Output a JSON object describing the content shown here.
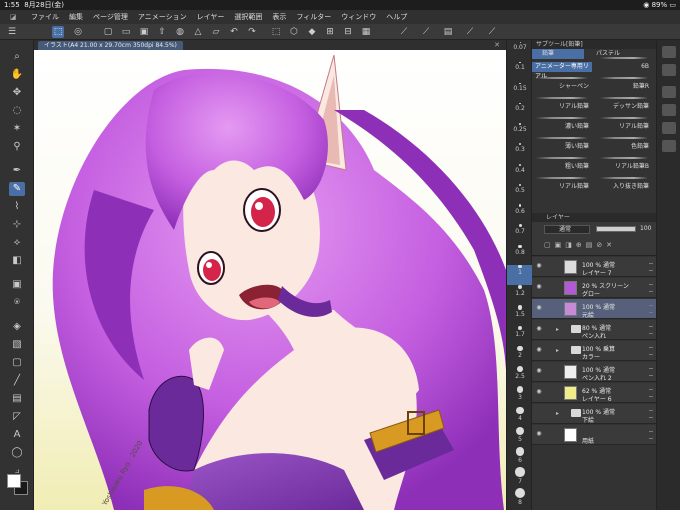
{
  "status": {
    "time": "1:55",
    "date": "8月28日(金)",
    "battery": "89%"
  },
  "menu": {
    "items": [
      "ファイル",
      "編集",
      "ページ管理",
      "アニメーション",
      "レイヤー",
      "選択範囲",
      "表示",
      "フィルター",
      "ウィンドウ",
      "ヘルプ"
    ]
  },
  "document": {
    "tab_label": "イラスト(A4 21.00 x 29.70cm 350dpi 84.5%)"
  },
  "brush_sizes": [
    "0.07",
    "0.1",
    "0.15",
    "0.2",
    "0.25",
    "0.3",
    "0.4",
    "0.5",
    "0.6",
    "0.7",
    "0.8",
    "1",
    "1.2",
    "1.5",
    "1.7",
    "2",
    "2.5",
    "3",
    "4",
    "5",
    "6",
    "7",
    "8"
  ],
  "active_brush_size": "1",
  "subtool": {
    "title": "サブツール[鉛筆]",
    "tabs": [
      "鉛筆",
      "パステル"
    ],
    "active_tab": "鉛筆",
    "selected_brush": "アニメーター専用リアル",
    "brushes": [
      "6B",
      "シャーペン",
      "鉛筆R",
      "リアル鉛筆",
      "デッサン鉛筆",
      "濃い鉛筆",
      "リアル鉛筆",
      "薄い鉛筆",
      "色鉛筆",
      "粗い鉛筆",
      "リアル鉛筆B",
      "リアル鉛筆",
      "入り抜き鉛筆"
    ]
  },
  "layer_panel": {
    "title": "レイヤー",
    "blend_mode": "通常",
    "opacity": "100",
    "opacity_fraction": 1.0,
    "layers": [
      {
        "line1": "100 % 通常",
        "line2": "レイヤー 7",
        "folder": false,
        "selected": false,
        "visible": true,
        "thumb": "#dcdcdc"
      },
      {
        "line1": "20 % スクリーン",
        "line2": "グロー",
        "folder": false,
        "selected": false,
        "visible": true,
        "thumb": "#b25ad6"
      },
      {
        "line1": "100 % 通常",
        "line2": "元絵",
        "folder": false,
        "selected": true,
        "visible": true,
        "thumb": "#c58ad8"
      },
      {
        "line1": "80 % 通常",
        "line2": "ペン入れ",
        "folder": true,
        "selected": false,
        "visible": true,
        "thumb": "#d8d8d8"
      },
      {
        "line1": "100 % 乗算",
        "line2": "カラー",
        "folder": true,
        "selected": false,
        "visible": true,
        "thumb": "#d8d8d8"
      },
      {
        "line1": "100 % 通常",
        "line2": "ペン入れ 2",
        "folder": false,
        "selected": false,
        "visible": true,
        "thumb": "#eeeeee"
      },
      {
        "line1": "62 % 通常",
        "line2": "レイヤー 6",
        "folder": false,
        "selected": false,
        "visible": true,
        "thumb": "#f1ec8a"
      },
      {
        "line1": "100 % 通常",
        "line2": "下絵",
        "folder": true,
        "selected": false,
        "visible": false,
        "thumb": "#d8d8d8"
      },
      {
        "line1": "",
        "line2": "用紙",
        "folder": false,
        "selected": false,
        "visible": true,
        "thumb": "#ffffff"
      }
    ]
  },
  "artwork": {
    "signature": "Yoshisoku Ryo · 2020",
    "colors": {
      "hair": "#c45ee0",
      "hair_shadow": "#8e2fb8",
      "skin": "#fbe9e1",
      "skin_shadow": "#e9b9b4",
      "eye": "#d4244a",
      "costume": "#6b2a9a",
      "gold": "#d89a22",
      "background_top": "#ffffff",
      "background_bottom": "#f1edb4"
    }
  }
}
